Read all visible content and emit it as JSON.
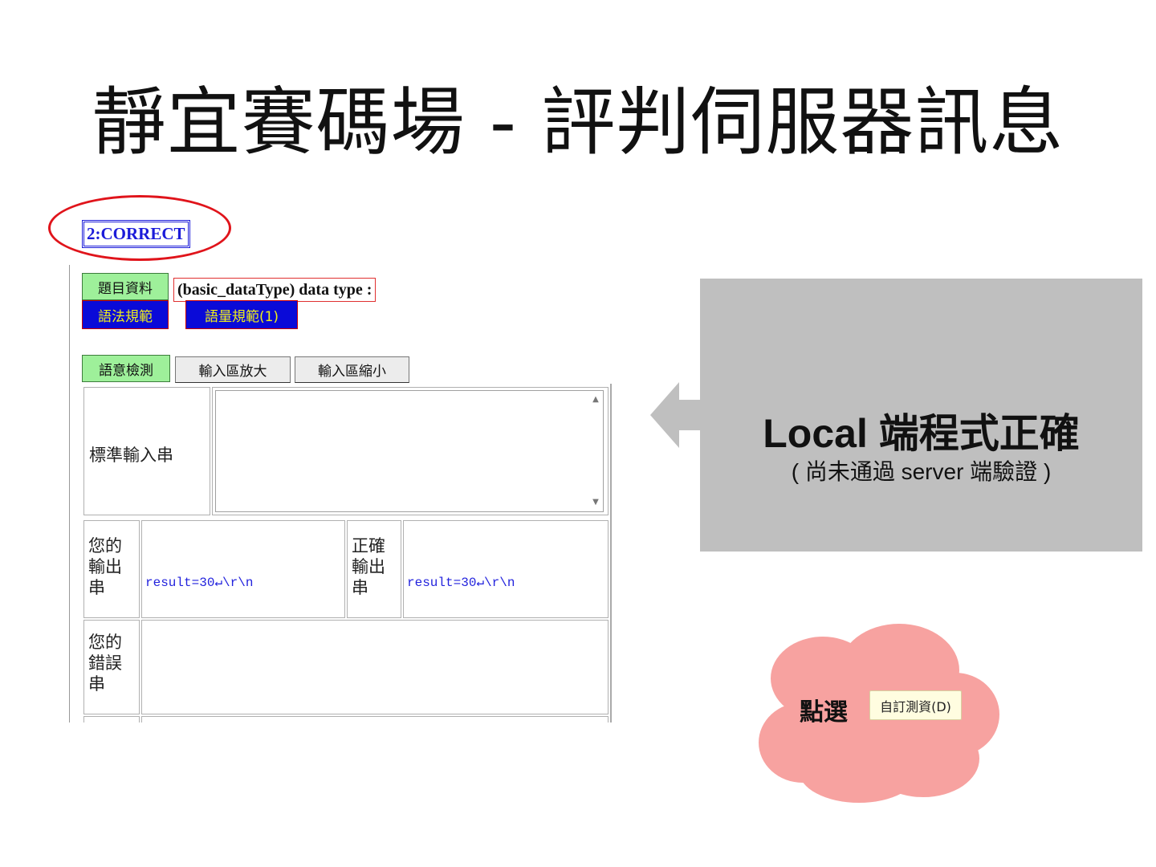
{
  "slide": {
    "title": "靜宜賽碼場 - 評判伺服器訊息"
  },
  "status": {
    "label": "2:CORRECT"
  },
  "problem": {
    "info_button": "題目資料",
    "title": "(basic_dataType) data type :",
    "syntax_button": "語法規範",
    "quantity_button": "語量規範(1)"
  },
  "toolbar": {
    "semantic_check": "語意檢測",
    "enlarge_input": "輸入區放大",
    "shrink_input": "輸入區縮小"
  },
  "io": {
    "stdin_label": "標準輸入串",
    "stdin_value": "",
    "your_output_label": "您的輸出串",
    "your_output_value": "result=30↵\\r\\n",
    "correct_output_label": "正確輸出串",
    "correct_output_value": "result=30↵\\r\\n",
    "your_error_label": "您的錯誤串",
    "your_error_value": ""
  },
  "callout": {
    "title": "Local 端程式正確",
    "subtitle": "( 尚未通過 server 端驗證 )"
  },
  "cloud": {
    "text": "點選",
    "button": "自訂測資(D)"
  },
  "colors": {
    "status_blue": "#1b1bd9",
    "oval_red": "#e0141b",
    "callout_gray": "#bfbfbf",
    "cloud_pink": "#f7a2a0"
  }
}
